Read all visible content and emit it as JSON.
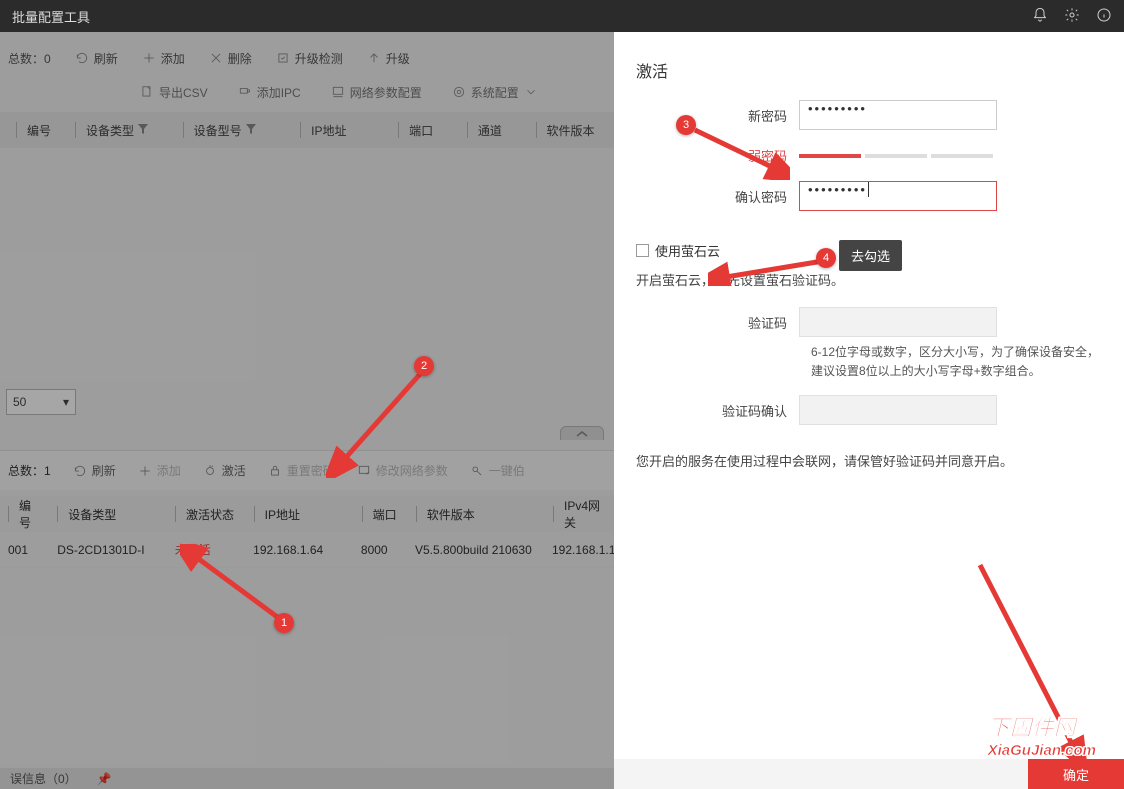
{
  "titlebar": {
    "title": "批量配置工具"
  },
  "upper": {
    "count_label": "总数：0",
    "tools": {
      "refresh": "刷新",
      "add": "添加",
      "delete": "删除",
      "upgrade_check": "升级检测",
      "upgrade": "升级",
      "export_csv": "导出CSV",
      "add_ipc": "添加IPC",
      "net_param": "网络参数配置",
      "sys_config": "系统配置"
    },
    "headers": {
      "id": "编号",
      "dev_type": "设备类型",
      "dev_model": "设备型号",
      "ip": "IP地址",
      "port": "端口",
      "channel": "通道",
      "sw_ver": "软件版本"
    },
    "page_size": "50"
  },
  "lower": {
    "count_label": "总数：1",
    "tools": {
      "refresh": "刷新",
      "add": "添加",
      "activate": "激活",
      "reset_pwd": "重置密码",
      "mod_net": "修改网络参数",
      "onekey": "一键伯"
    },
    "headers": {
      "id": "编号",
      "dev_type": "设备类型",
      "act_status": "激活状态",
      "ip": "IP地址",
      "port": "端口",
      "sw_ver": "软件版本",
      "gateway": "IPv4网关"
    },
    "row": {
      "id": "001",
      "dev_type": "DS-2CD1301D-I",
      "act_status": "未激活",
      "ip": "192.168.1.64",
      "port": "8000",
      "sw_ver": "V5.5.800build 210630",
      "gateway": "192.168.1.1"
    }
  },
  "errorbar": {
    "label": "误信息（0）"
  },
  "panel": {
    "title": "激活",
    "new_pwd_label": "新密码",
    "new_pwd_value": "•••••••••",
    "strength_label": "弱密码",
    "confirm_pwd_label": "确认密码",
    "confirm_pwd_value": "•••••••••",
    "checkbox_label": "使用萤石云",
    "hint1": "开启萤石云，请先设置萤石验证码。",
    "vcode_label": "验证码",
    "vcode_hint": "6-12位字母或数字，区分大小写，为了确保设备安全，建议设置8位以上的大小写字母+数字组合。",
    "vcode_confirm_label": "验证码确认",
    "notice": "您开启的服务在使用过程中会联网，请保管好验证码并同意开启。",
    "confirm_btn": "确定"
  },
  "annotations": {
    "b1": "1",
    "b2": "2",
    "b3": "3",
    "b4": "4",
    "uncheck_box": "去勾选"
  },
  "watermark": {
    "l1": "下固件网",
    "l2": "XiaGuJian.com"
  }
}
